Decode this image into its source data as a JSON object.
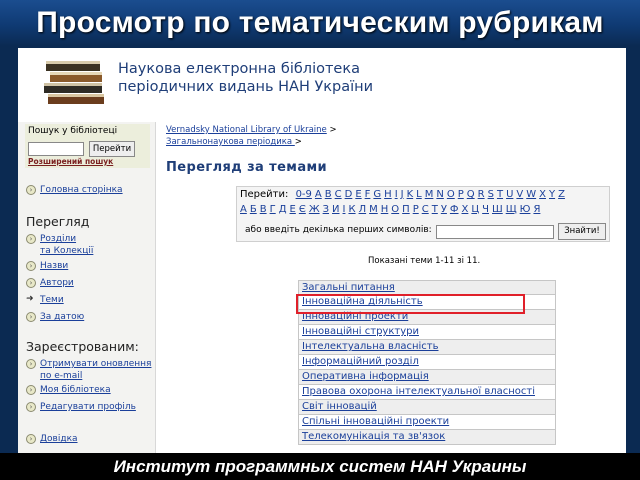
{
  "slide": {
    "title": "Просмотр по тематическим рубрикам",
    "footer": "Институт программных систем НАН Украины"
  },
  "banner": {
    "line1": "Наукова електронна бібліотека",
    "line2": "періодичних видань НАН України"
  },
  "sidebar": {
    "search_label": "Пошук у бібліотеці",
    "search_value": "",
    "search_button": "Перейти",
    "advanced_link": "Розширений пошук",
    "home": "Головна сторінка",
    "browse_heading": "Перегляд",
    "browse_items": [
      "Розділи",
      "та Колекції",
      "Назви",
      "Автори",
      "Теми",
      "За датою"
    ],
    "registered_heading": "Зареєстрованим:",
    "reg_items": [
      "Отримувати оновлення",
      "по e-mail",
      "Моя бібліотека",
      "Редагувати профіль"
    ],
    "help": "Довідка"
  },
  "content": {
    "breadcrumb_1": "Vernadsky National Library of Ukraine",
    "breadcrumb_2": "Загальнонаукова періодика ",
    "breadcrumb_sep": ">",
    "page_heading": "Перегляд за темами",
    "jump_label": "Перейти:",
    "latin": [
      "0-9",
      "A",
      "B",
      "C",
      "D",
      "E",
      "F",
      "G",
      "H",
      "I",
      "J",
      "K",
      "L",
      "M",
      "N",
      "O",
      "P",
      "Q",
      "R",
      "S",
      "T",
      "U",
      "V",
      "W",
      "X",
      "Y",
      "Z"
    ],
    "cyrillic": [
      "А",
      "Б",
      "В",
      "Г",
      "Д",
      "Е",
      "Є",
      "Ж",
      "З",
      "И",
      "І",
      "К",
      "Л",
      "М",
      "Н",
      "О",
      "П",
      "Р",
      "С",
      "Т",
      "У",
      "Ф",
      "Х",
      "Ц",
      "Ч",
      "Ш",
      "Щ",
      "Ю",
      "Я"
    ],
    "first_chars_label": "або введіть декілька перших символів:",
    "first_chars_value": "",
    "go_button": "Знайти!",
    "shown_text": "Показані теми 1-11 зі 11.",
    "topics": [
      "Загальні питання",
      "Інноваційна діяльність",
      "Інноваційні проекти",
      "Інноваційні структури",
      "Інтелектуальна власність",
      "Інформаційний розділ",
      "Оперативна інформація",
      "Правова охорона інтелектуальної власності",
      "Світ інновацій",
      "Спільні інноваційні проекти",
      "Телекомунікація та зв'язок"
    ],
    "highlight_color": "#e0202a"
  }
}
